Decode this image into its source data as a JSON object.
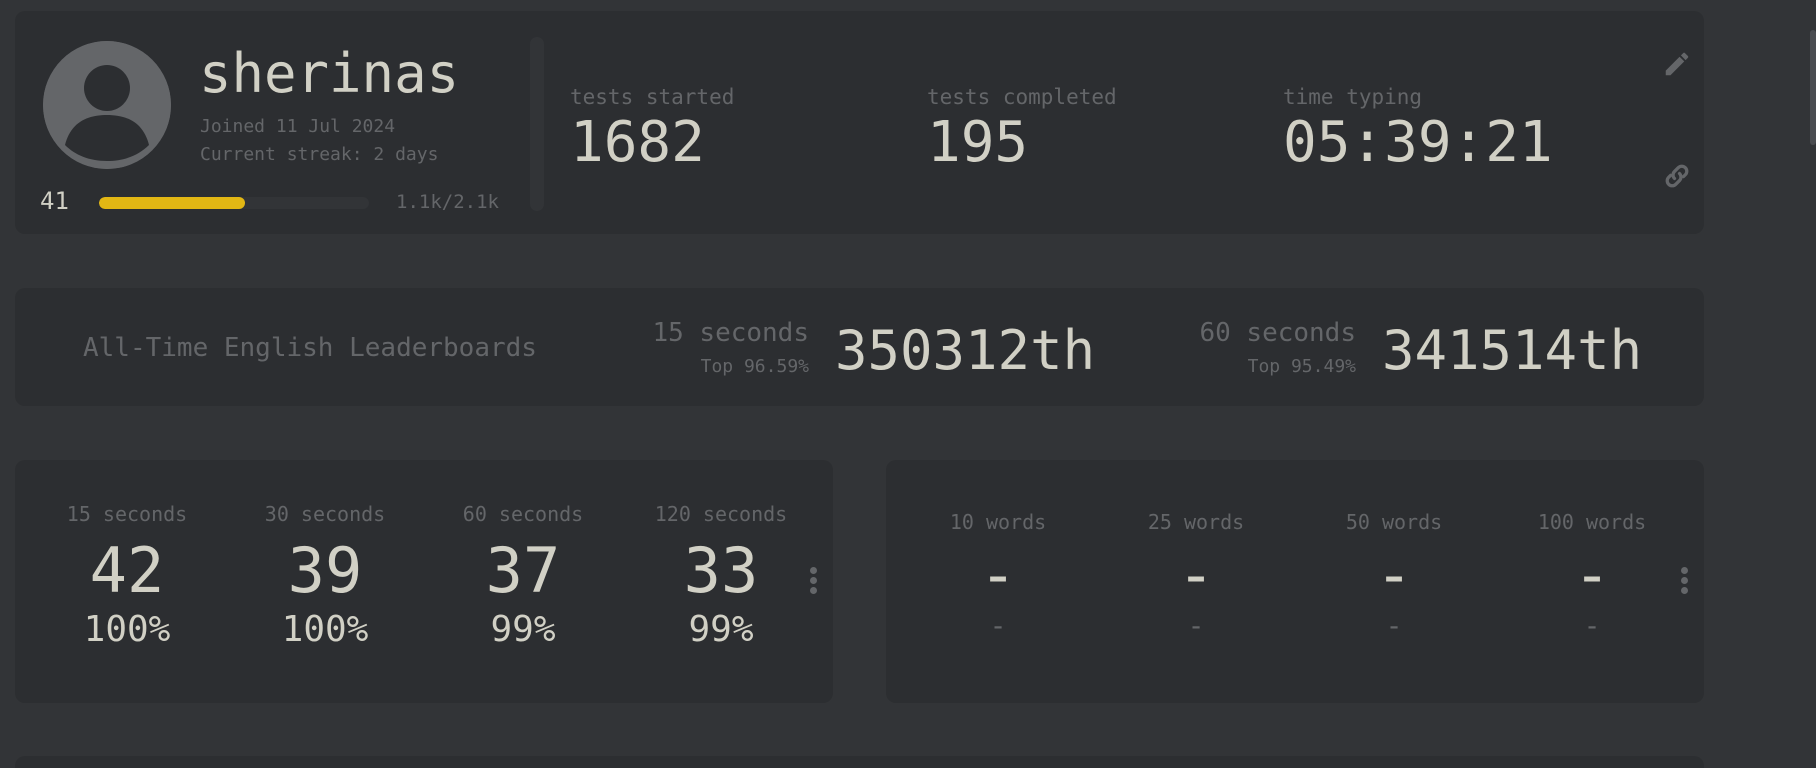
{
  "profile": {
    "username": "sherinas",
    "joined": "Joined 11 Jul 2024",
    "streak": "Current streak: 2 days",
    "level": "41",
    "xp_text": "1.1k/2.1k",
    "xp_progress": 0.54,
    "accent_color": "#e2b714",
    "avatar_icon": "user-avatar-icon",
    "edit_icon": "pencil-icon",
    "link_icon": "link-icon"
  },
  "stats": {
    "tests_started_label": "tests started",
    "tests_started": "1682",
    "tests_completed_label": "tests completed",
    "tests_completed": "195",
    "time_typing_label": "time typing",
    "time_typing": "05:39:21"
  },
  "leaderboards": {
    "title": "All-Time English Leaderboards",
    "entries": [
      {
        "mode": "15 seconds",
        "top": "Top 96.59%",
        "rank": "350312th"
      },
      {
        "mode": "60 seconds",
        "top": "Top 95.49%",
        "rank": "341514th"
      }
    ]
  },
  "time_pbs": [
    {
      "label": "15 seconds",
      "wpm": "42",
      "acc": "100%"
    },
    {
      "label": "30 seconds",
      "wpm": "39",
      "acc": "100%"
    },
    {
      "label": "60 seconds",
      "wpm": "37",
      "acc": "99%"
    },
    {
      "label": "120 seconds",
      "wpm": "33",
      "acc": "99%"
    }
  ],
  "word_pbs": [
    {
      "label": "10 words",
      "wpm": "-",
      "acc": "-"
    },
    {
      "label": "25 words",
      "wpm": "-",
      "acc": "-"
    },
    {
      "label": "50 words",
      "wpm": "-",
      "acc": "-"
    },
    {
      "label": "100 words",
      "wpm": "-",
      "acc": "-"
    }
  ]
}
